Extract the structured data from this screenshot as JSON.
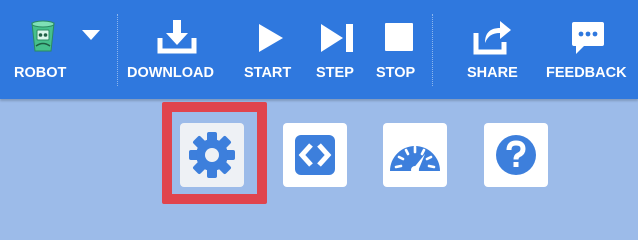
{
  "toolbar": {
    "robot_label": "ROBOT",
    "download_label": "DOWNLOAD",
    "start_label": "START",
    "step_label": "STEP",
    "stop_label": "STOP",
    "share_label": "SHARE",
    "feedback_label": "FEEDBACK"
  },
  "icons": {
    "robot": "robot-icon",
    "dropdown": "caret-down-icon",
    "download": "download-icon",
    "start": "play-icon",
    "step": "step-icon",
    "stop": "stop-icon",
    "share": "share-icon",
    "feedback": "feedback-icon",
    "settings": "gear-icon",
    "code": "code-icon",
    "speed": "gauge-icon",
    "help": "question-icon"
  },
  "colors": {
    "toolbar_bg": "#2f78de",
    "page_bg": "#9cbbe9",
    "tile_bg": "#ffffff",
    "icon_blue": "#3d7fdc",
    "highlight": "#e0444d",
    "robot_green": "#46c08c"
  },
  "state": {
    "selected_tile": "settings"
  }
}
